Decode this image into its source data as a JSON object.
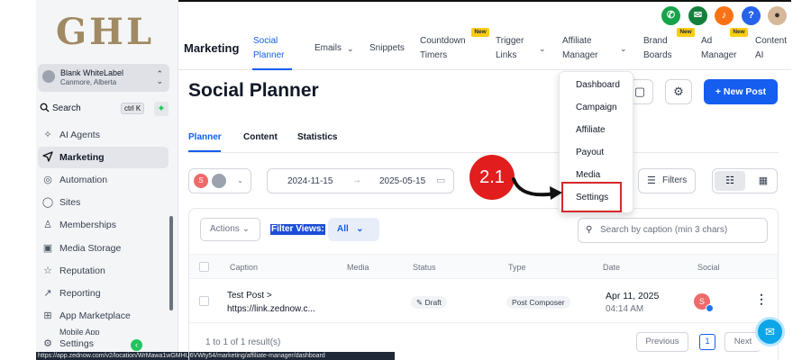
{
  "logo_text": "GHL",
  "account": {
    "name": "Blank WhiteLabel",
    "location": "Canmore, Alberta"
  },
  "search": {
    "label": "Search",
    "shortcut": "ctrl K"
  },
  "sidebar": {
    "items": [
      {
        "label": "AI Agents",
        "icon": "sparkle-icon"
      },
      {
        "label": "Marketing",
        "icon": "send-icon"
      },
      {
        "label": "Automation",
        "icon": "automation-icon"
      },
      {
        "label": "Sites",
        "icon": "globe-icon"
      },
      {
        "label": "Memberships",
        "icon": "ribbon-icon"
      },
      {
        "label": "Media Storage",
        "icon": "image-icon"
      },
      {
        "label": "Reputation",
        "icon": "star-icon"
      },
      {
        "label": "Reporting",
        "icon": "trend-icon"
      },
      {
        "label": "App Marketplace",
        "icon": "grid-icon"
      },
      {
        "label": "Mobile App",
        "icon": "phone-icon"
      },
      {
        "label": "Settings",
        "icon": "gear-icon"
      }
    ]
  },
  "status_url": "https://app.zednow.com/v2/location/WrMawa1wGMHU6VWty54/marketing/affiliate-manager/dashboard",
  "topnav": {
    "title": "Marketing",
    "items": [
      {
        "label": "Social\nPlanner",
        "active": true
      },
      {
        "label": "Emails"
      },
      {
        "label": "Snippets"
      },
      {
        "label": "Countdown\nTimers",
        "badge": "New"
      },
      {
        "label": "Trigger\nLinks"
      },
      {
        "label": "Affiliate\nManager"
      },
      {
        "label": "Brand\nBoards",
        "badge": "New"
      },
      {
        "label": "Ad\nManager",
        "badge": "New"
      },
      {
        "label": "Content\nAI"
      }
    ]
  },
  "page": {
    "title": "Social Planner",
    "new_post": "New Post",
    "subtabs": [
      "Planner",
      "Content",
      "Statistics"
    ]
  },
  "filters": {
    "account_avatar": "S",
    "date_from": "2024-11-15",
    "date_to": "2025-05-15",
    "filters_label": "Filters"
  },
  "table": {
    "actions_label": "Actions",
    "filter_views_label": "Filter Views:",
    "filter_views_value": "All",
    "search_placeholder": "Search by caption (min 3 chars)",
    "columns": [
      "Caption",
      "Media",
      "Status",
      "Type",
      "Date",
      "Social"
    ],
    "rows": [
      {
        "caption_line1": "Test Post >",
        "caption_line2": "https://link.zednow.c...",
        "status": "Draft",
        "type": "Post Composer",
        "date": "Apr 11, 2025",
        "time": "04:14 AM",
        "social_avatar": "S"
      }
    ],
    "result_count": "1 to 1 of 1 result(s)",
    "pagination": {
      "previous": "Previous",
      "current": "1",
      "next": "Next"
    }
  },
  "dropdown": {
    "items": [
      "Dashboard",
      "Campaign",
      "Affiliate",
      "Payout",
      "Media",
      "Settings"
    ],
    "highlighted": "Settings"
  },
  "annotation": {
    "step": "2.1"
  },
  "colors": {
    "accent": "#155eef",
    "annotation_red": "#e11d1d",
    "logo_gold": "#a08a64",
    "new_badge": "#facc15"
  }
}
